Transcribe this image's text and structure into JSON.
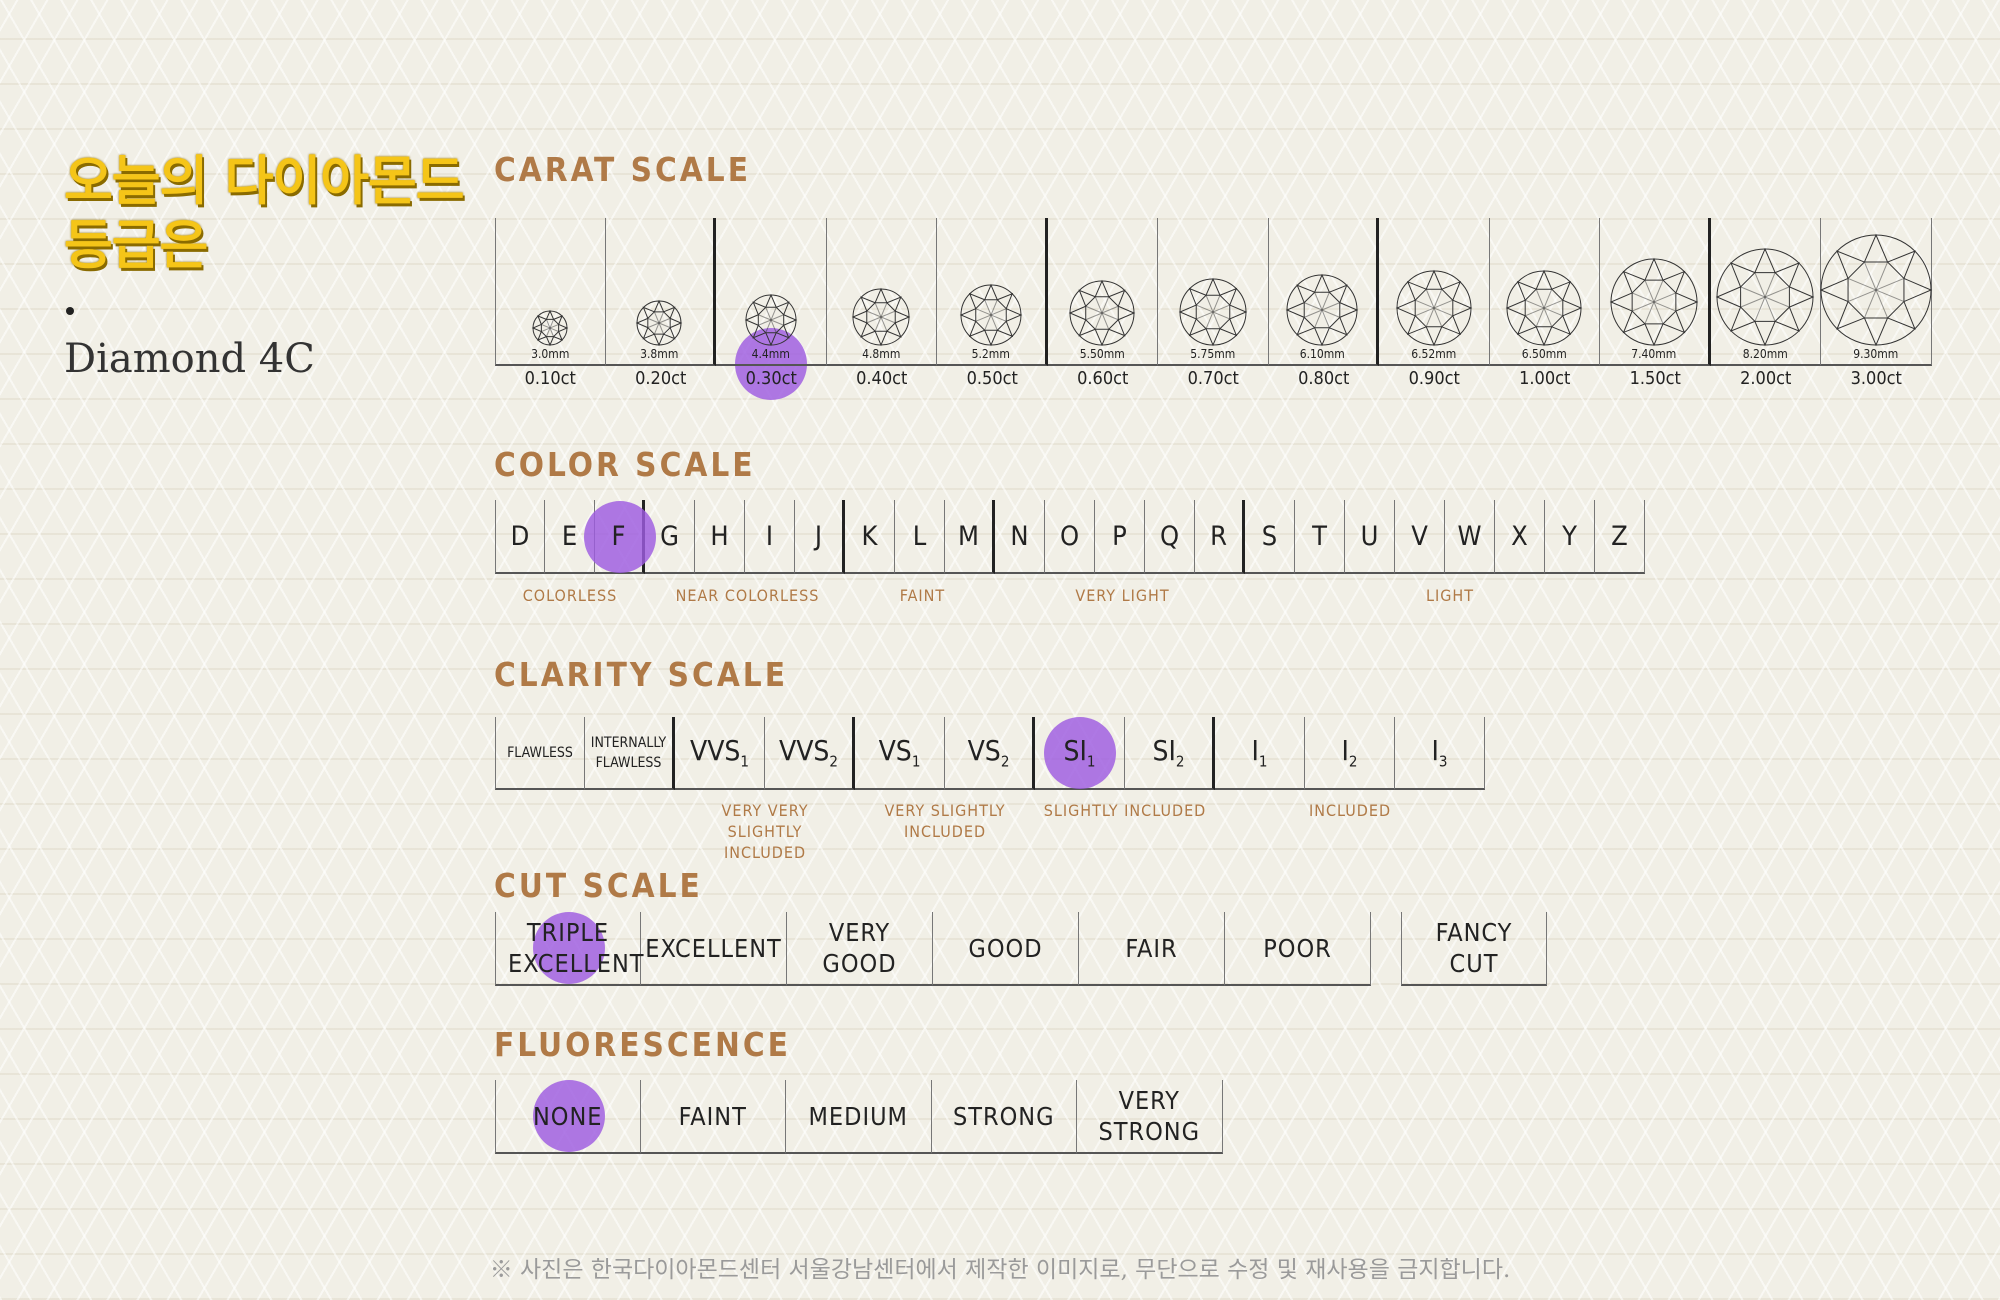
{
  "title_ko_line1": "오늘의 다이아몬드",
  "title_ko_line2": "등급은",
  "subtitle": "Diamond 4C",
  "highlight_color": "#9d5be0",
  "carat": {
    "title": "CARAT SCALE",
    "items": [
      {
        "mm": "3.0mm",
        "ct": "0.10ct"
      },
      {
        "mm": "3.8mm",
        "ct": "0.20ct"
      },
      {
        "mm": "4.4mm",
        "ct": "0.30ct",
        "selected": true
      },
      {
        "mm": "4.8mm",
        "ct": "0.40ct"
      },
      {
        "mm": "5.2mm",
        "ct": "0.50ct"
      },
      {
        "mm": "5.50mm",
        "ct": "0.60ct"
      },
      {
        "mm": "5.75mm",
        "ct": "0.70ct"
      },
      {
        "mm": "6.10mm",
        "ct": "0.80ct"
      },
      {
        "mm": "6.52mm",
        "ct": "0.90ct"
      },
      {
        "mm": "6.50mm",
        "ct": "1.00ct"
      },
      {
        "mm": "7.40mm",
        "ct": "1.50ct"
      },
      {
        "mm": "8.20mm",
        "ct": "2.00ct"
      },
      {
        "mm": "9.30mm",
        "ct": "3.00ct"
      }
    ]
  },
  "color": {
    "title": "COLOR SCALE",
    "letters": [
      "D",
      "E",
      "F",
      "G",
      "H",
      "I",
      "J",
      "K",
      "L",
      "M",
      "N",
      "O",
      "P",
      "Q",
      "R",
      "S",
      "T",
      "U",
      "V",
      "W",
      "X",
      "Y",
      "Z"
    ],
    "selected": "F",
    "groups": [
      "COLORLESS",
      "NEAR COLORLESS",
      "FAINT",
      "VERY LIGHT",
      "LIGHT"
    ]
  },
  "clarity": {
    "title": "CLARITY SCALE",
    "items": [
      {
        "base": "FLAWLESS",
        "sub": "",
        "small": true
      },
      {
        "base": "INTERNALLY FLAWLESS",
        "sub": "",
        "small": true
      },
      {
        "base": "VVS",
        "sub": "1"
      },
      {
        "base": "VVS",
        "sub": "2"
      },
      {
        "base": "VS",
        "sub": "1"
      },
      {
        "base": "VS",
        "sub": "2"
      },
      {
        "base": "SI",
        "sub": "1",
        "selected": true
      },
      {
        "base": "SI",
        "sub": "2"
      },
      {
        "base": "I",
        "sub": "1"
      },
      {
        "base": "I",
        "sub": "2"
      },
      {
        "base": "I",
        "sub": "3"
      }
    ],
    "groups": [
      "VERY VERY SLIGHTLY INCLUDED",
      "VERY SLIGHTLY INCLUDED",
      "SLIGHTLY INCLUDED",
      "INCLUDED"
    ]
  },
  "cut": {
    "title": "CUT SCALE",
    "items": [
      "TRIPLE EXCELLENT",
      "EXCELLENT",
      "VERY GOOD",
      "GOOD",
      "FAIR",
      "POOR"
    ],
    "selected": "TRIPLE EXCELLENT",
    "fancy": "FANCY CUT"
  },
  "fluorescence": {
    "title": "FLUORESCENCE",
    "items": [
      "NONE",
      "FAINT",
      "MEDIUM",
      "STRONG",
      "VERY STRONG"
    ],
    "selected": "NONE"
  },
  "footer": "※ 사진은 한국다이아몬드센터 서울강남센터에서 제작한 이미지로, 무단으로 수정 및 재사용을 금지합니다."
}
